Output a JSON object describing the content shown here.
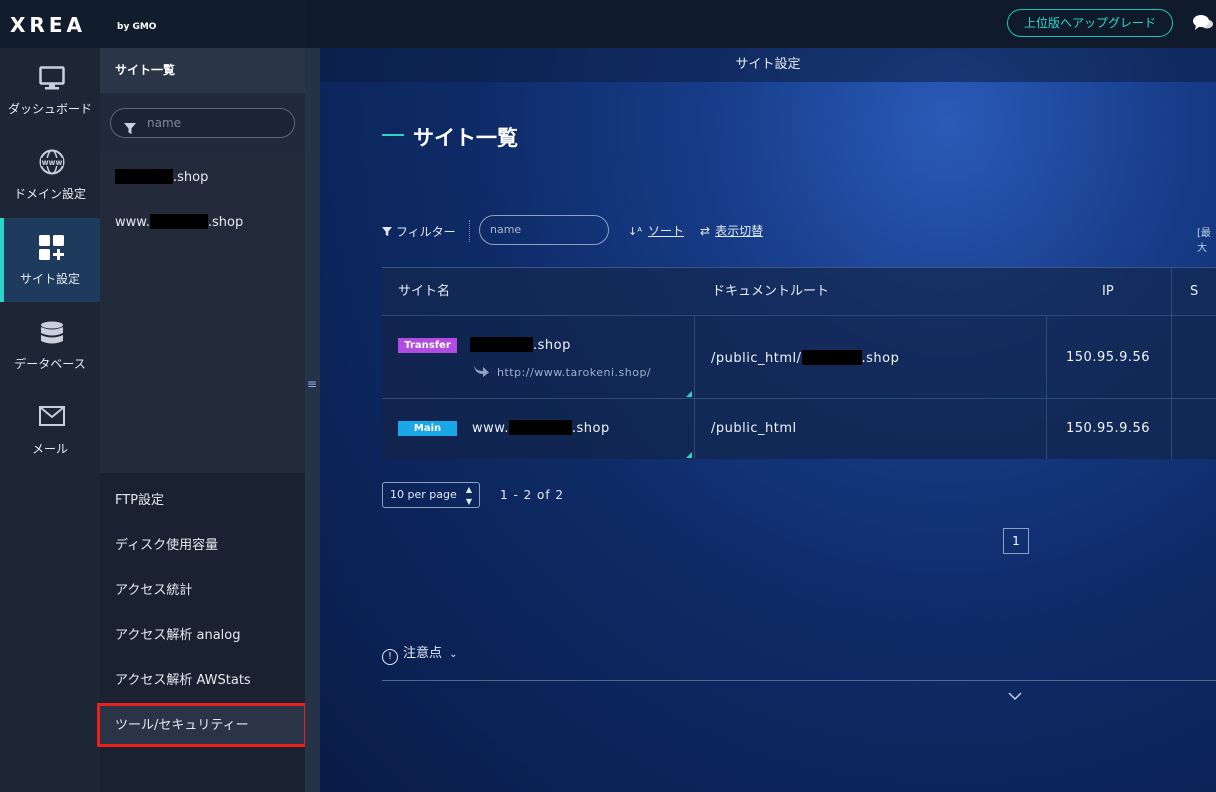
{
  "app": {
    "logo": "XREA",
    "logo_sub": "by GMO",
    "upgrade_label": "上位版へアップグレード"
  },
  "iconbar": {
    "items": [
      {
        "label": "ダッシュボード",
        "icon": "monitor-icon"
      },
      {
        "label": "ドメイン設定",
        "icon": "www-globe-icon"
      },
      {
        "label": "サイト設定",
        "icon": "grid-plus-icon",
        "active": true
      },
      {
        "label": "データベース",
        "icon": "database-icon"
      },
      {
        "label": "メール",
        "icon": "envelope-icon"
      }
    ]
  },
  "subbar": {
    "header": "サイト一覧",
    "search_placeholder": "name",
    "sites": [
      {
        "prefix": "",
        "suffix": ".shop"
      },
      {
        "prefix": "www.",
        "suffix": ".shop"
      }
    ],
    "menu": [
      "FTP設定",
      "ディスク使用容量",
      "アクセス統計",
      "アクセス解析 analog",
      "アクセス解析 AWStats",
      "ツール/セキュリティー"
    ]
  },
  "main": {
    "top_title": "サイト設定",
    "page_title": "サイト一覧",
    "toolbar": {
      "filter_label": "フィルター",
      "filter_placeholder": "name",
      "sort_label": "ソート",
      "toggle_label": "表示切替",
      "max_label": "[最大"
    },
    "table": {
      "headers": [
        "サイト名",
        "ドキュメントルート",
        "IP",
        "S"
      ],
      "rows": [
        {
          "badge": "Transfer",
          "badge_color": "#b04de0",
          "site_prefix": "",
          "site_suffix": ".shop",
          "redirect": "http://www.tarokeni.shop/",
          "docroot_prefix": "/public_html/",
          "docroot_suffix": ".shop",
          "ip": "150.95.9.56"
        },
        {
          "badge": "Main",
          "badge_color": "#1aa7e8",
          "site_prefix": "www.",
          "site_suffix": ".shop",
          "docroot_prefix": "/public_html",
          "docroot_suffix": "",
          "ip": "150.95.9.56"
        }
      ]
    },
    "pagination": {
      "per_page": "10 per page",
      "range": "1 - 2 of 2",
      "current_page": "1"
    },
    "note_label": "注意点"
  },
  "colors": {
    "accent": "#2dd4c6",
    "highlight_box": "#e8221a"
  }
}
